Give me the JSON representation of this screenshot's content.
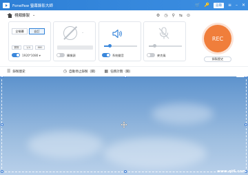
{
  "app": {
    "title": "FonePaw 螢幕錄影大師",
    "register_label": "註冊",
    "mode_label": "視頻錄製",
    "mode_chevron": "⌄"
  },
  "window_controls": {
    "cart": "🛒",
    "key": "🔑",
    "menu": "≡",
    "minimize": "–",
    "close": "✕"
  },
  "toolbar_icons": [
    "⚙",
    "◷",
    "⚲",
    "⇆",
    "⊙"
  ],
  "area_panel": {
    "fullscreen_label": "全螢幕",
    "custom_label": "自訂",
    "size_labels": [
      "實際",
      "1/4",
      "880"
    ],
    "toggle_label": "1920*1080 ▾",
    "toggle_on": true
  },
  "camera_panel": {
    "toggle_label": "攝像頭",
    "toggle_on": false,
    "icon": "camera-off-icon"
  },
  "system_audio_panel": {
    "toggle_label": "系統聲音",
    "toggle_on": true,
    "volume": 0.18
  },
  "mic_panel": {
    "toggle_label": "麥克風",
    "toggle_on": false,
    "volume": 0.18
  },
  "record": {
    "rec_label": "REC",
    "history_label": "錄製歷史"
  },
  "bottom": {
    "history": "錄製歷史",
    "schedule": "自動停止錄製（關）",
    "task": "任務計劃（關）"
  },
  "watermark": "www.qt6.com"
}
